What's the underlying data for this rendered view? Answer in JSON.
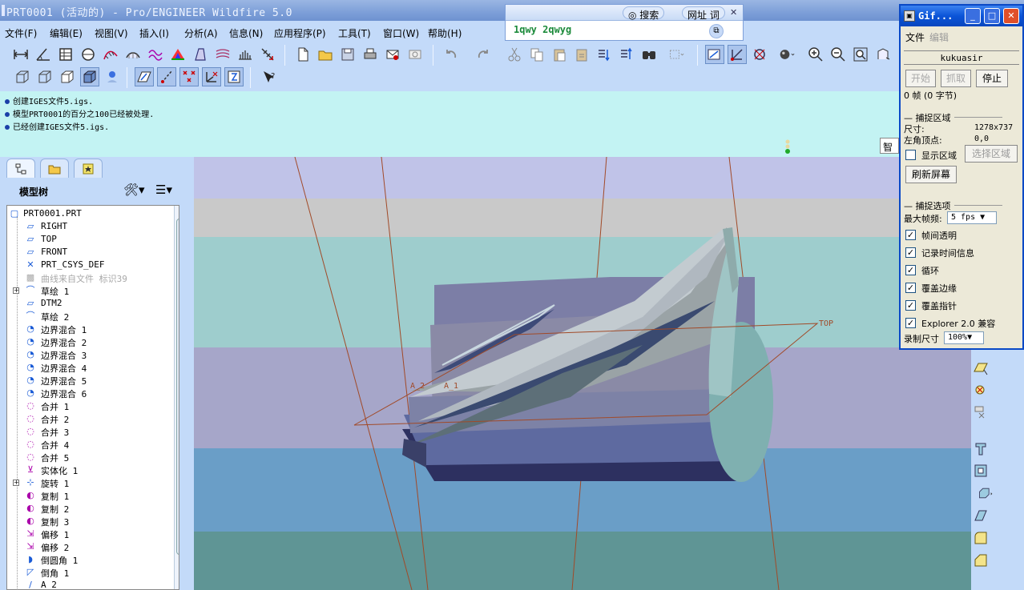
{
  "window": {
    "title": "PRT0001 (活动的) - Pro/ENGINEER Wildfire 5.0"
  },
  "menubar": [
    "文件(F)",
    "编辑(E)",
    "视图(V)",
    "插入(I)",
    "分析(A)",
    "信息(N)",
    "应用程序(P)",
    "工具(T)",
    "窗口(W)",
    "帮助(H)"
  ],
  "messages": [
    "创建IGES文件5.igs.",
    "模型PRT0001的百分之100已经被处理.",
    "已经创建IGES文件5.igs."
  ],
  "smart_filter": "智能",
  "model_tree": {
    "title": "模型树",
    "items": [
      {
        "label": "PRT0001.PRT",
        "icon": "part-icon"
      },
      {
        "label": "RIGHT",
        "icon": "datum-plane-icon"
      },
      {
        "label": "TOP",
        "icon": "datum-plane-icon"
      },
      {
        "label": "FRONT",
        "icon": "datum-plane-icon"
      },
      {
        "label": "PRT_CSYS_DEF",
        "icon": "csys-icon"
      },
      {
        "label": "曲线来自文件 标识39",
        "icon": "curve-from-file-icon",
        "dim": true
      },
      {
        "label": "草绘 1",
        "icon": "sketch-icon",
        "expandable": true
      },
      {
        "label": "DTM2",
        "icon": "datum-plane-icon"
      },
      {
        "label": "草绘 2",
        "icon": "sketch-icon"
      },
      {
        "label": "边界混合 1",
        "icon": "boundary-blend-icon"
      },
      {
        "label": "边界混合 2",
        "icon": "boundary-blend-icon"
      },
      {
        "label": "边界混合 3",
        "icon": "boundary-blend-icon"
      },
      {
        "label": "边界混合 4",
        "icon": "boundary-blend-icon"
      },
      {
        "label": "边界混合 5",
        "icon": "boundary-blend-icon"
      },
      {
        "label": "边界混合 6",
        "icon": "boundary-blend-icon"
      },
      {
        "label": "合并 1",
        "icon": "merge-icon"
      },
      {
        "label": "合并 2",
        "icon": "merge-icon"
      },
      {
        "label": "合并 3",
        "icon": "merge-icon"
      },
      {
        "label": "合并 4",
        "icon": "merge-icon"
      },
      {
        "label": "合并 5",
        "icon": "merge-icon"
      },
      {
        "label": "实体化 1",
        "icon": "solidify-icon"
      },
      {
        "label": "旋转 1",
        "icon": "revolve-icon",
        "expandable": true
      },
      {
        "label": "复制 1",
        "icon": "copy-surface-icon"
      },
      {
        "label": "复制 2",
        "icon": "copy-surface-icon"
      },
      {
        "label": "复制 3",
        "icon": "copy-surface-icon"
      },
      {
        "label": "偏移 1",
        "icon": "offset-icon"
      },
      {
        "label": "偏移 2",
        "icon": "offset-icon"
      },
      {
        "label": "倒圆角 1",
        "icon": "round-icon"
      },
      {
        "label": "倒角 1",
        "icon": "chamfer-icon"
      },
      {
        "label": "A_2",
        "icon": "axis-icon"
      }
    ]
  },
  "graphics": {
    "datum_labels": {
      "top": "TOP",
      "a2": "A_2",
      "a1": "A_1"
    }
  },
  "search_popup": {
    "tab_search": "搜索",
    "tab_url": "网址",
    "tab_dict": "词",
    "query": "1qwy 2qwyg"
  },
  "gifcam": {
    "title": "Gif...",
    "menu_file": "文件",
    "menu_edit": "编辑",
    "user": "kukuasir",
    "btn_start": "开始",
    "btn_capture": "抓取",
    "btn_stop": "停止",
    "frames": "0 帧 (0 字节)",
    "region_title": "捕捉区域",
    "size_label": "尺寸:",
    "size_value": "1278x737",
    "origin_label": "左角顶点:",
    "origin_value": "0,0",
    "show_region": "显示区域",
    "select_region": "选择区域",
    "refresh": "刷新屏幕",
    "options_title": "捕捉选项",
    "max_fps_label": "最大帧频:",
    "max_fps_value": "5 fps",
    "options": [
      {
        "label": "帧间透明",
        "checked": true
      },
      {
        "label": "记录时间信息",
        "checked": true
      },
      {
        "label": "循环",
        "checked": true
      },
      {
        "label": "覆盖边缘",
        "checked": true
      },
      {
        "label": "覆盖指针",
        "checked": true
      },
      {
        "label": "Explorer 2.0 兼容",
        "checked": true
      }
    ],
    "record_size_label": "录制尺寸",
    "record_size_value": "100%"
  }
}
